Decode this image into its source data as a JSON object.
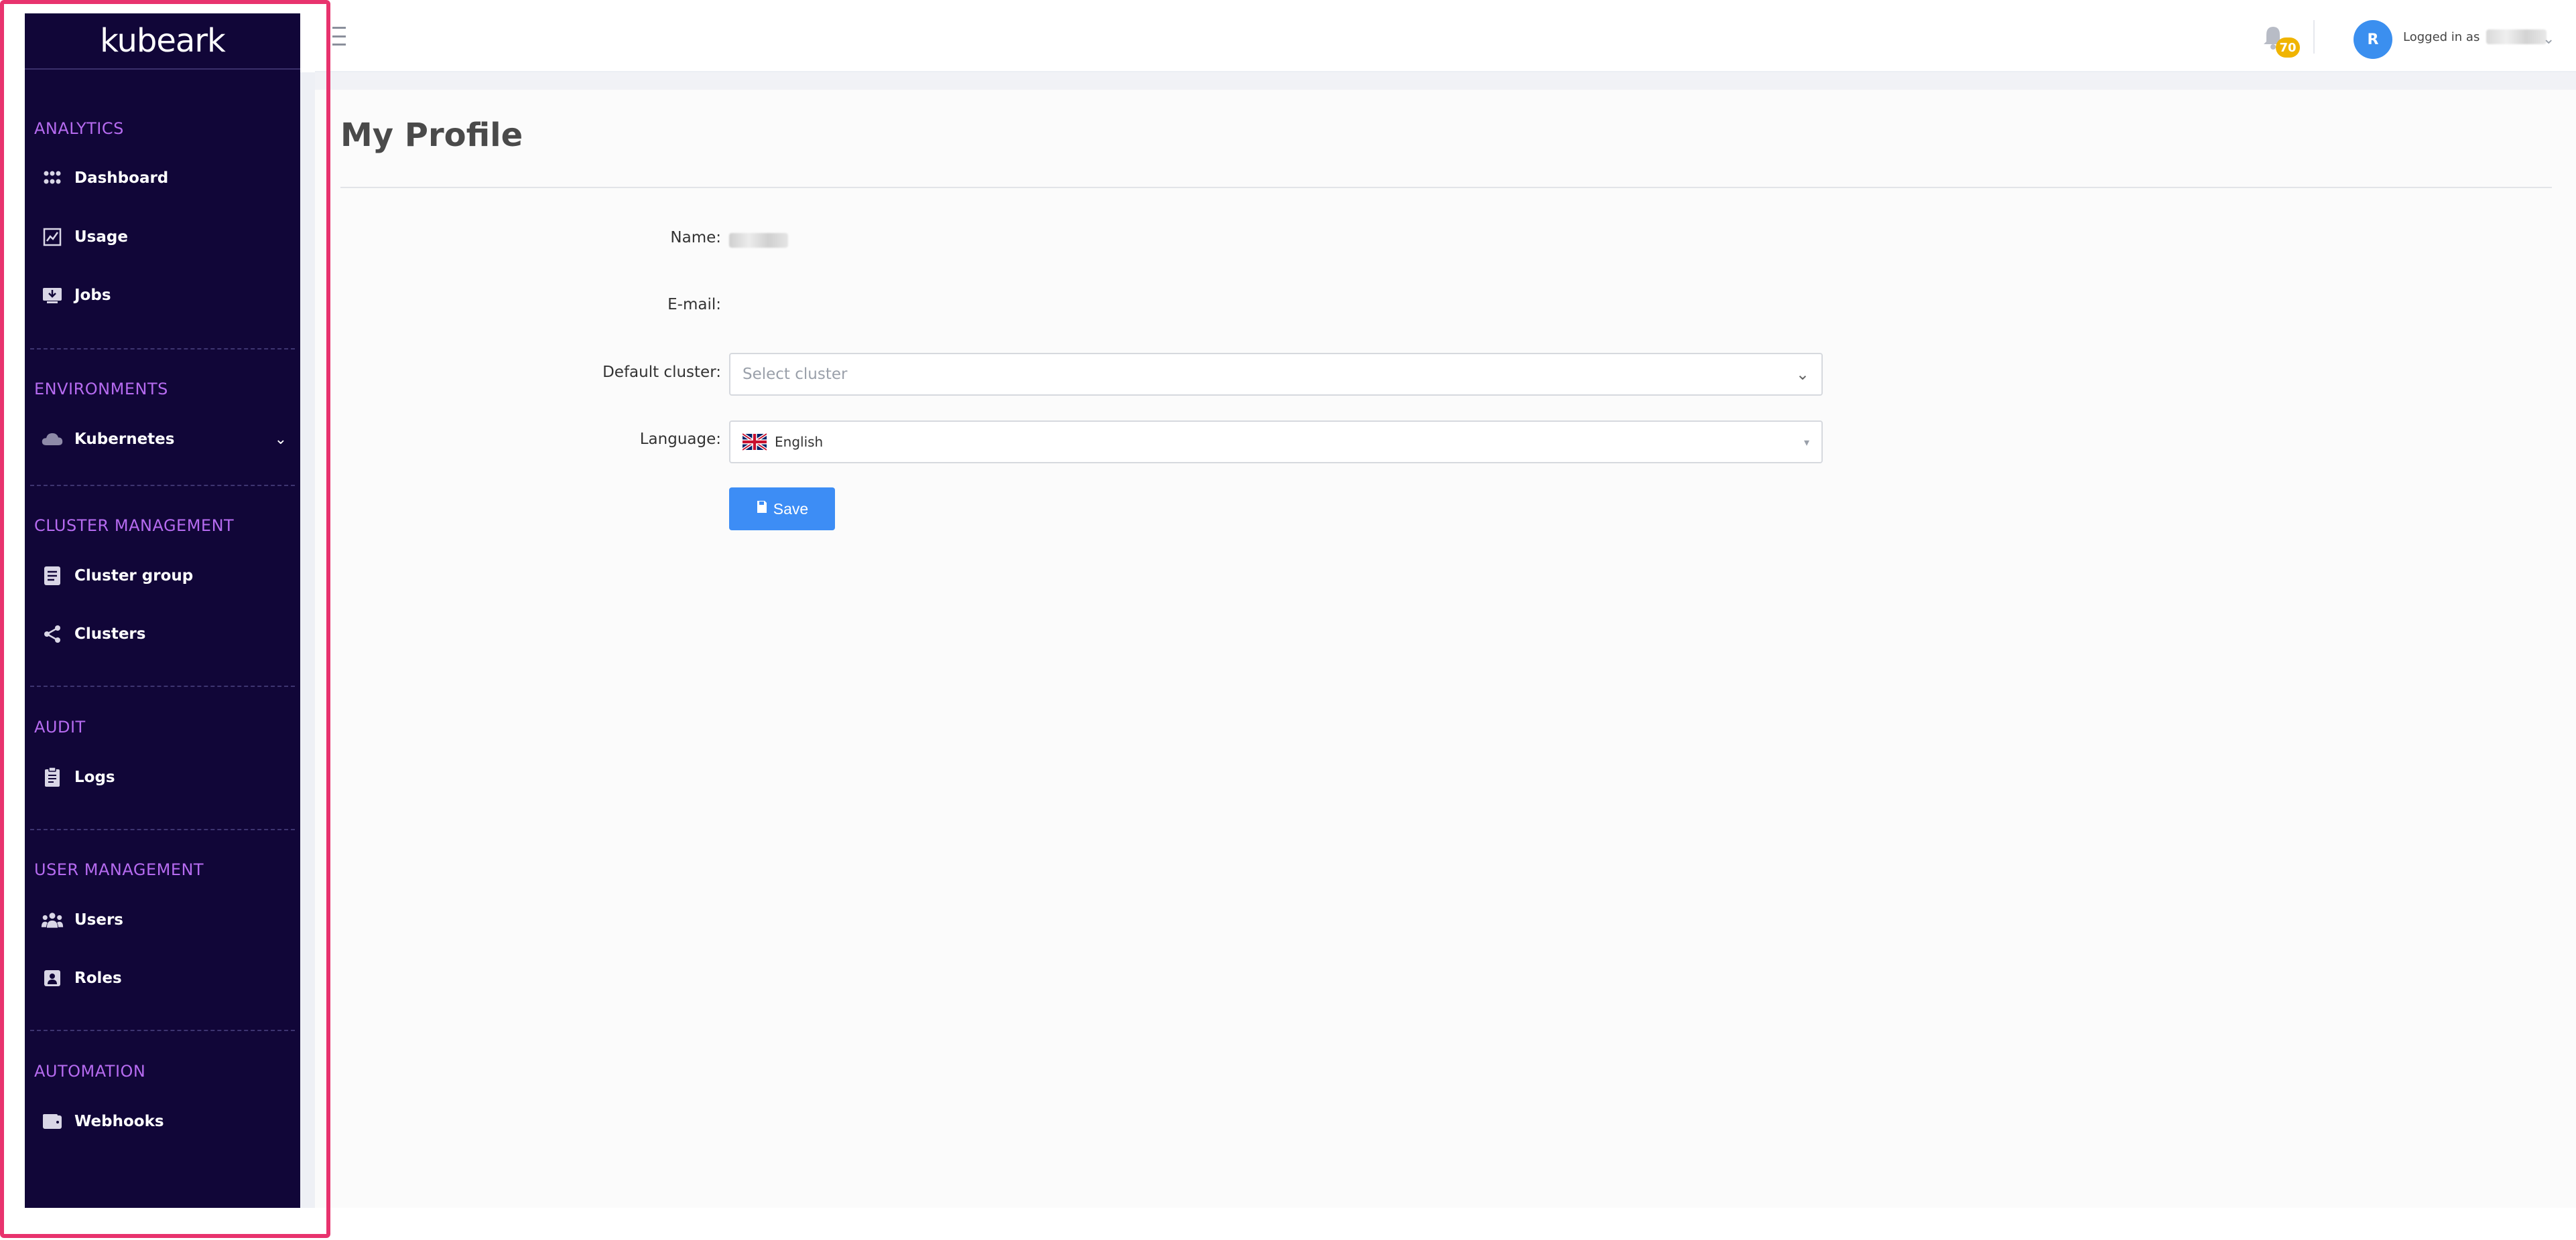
{
  "sidebar": {
    "brand": "kubeark",
    "sections": [
      {
        "title": "ANALYTICS",
        "items": [
          {
            "label": "Dashboard",
            "icon": "dashboard-icon"
          },
          {
            "label": "Usage",
            "icon": "chart-icon"
          },
          {
            "label": "Jobs",
            "icon": "jobs-icon"
          }
        ]
      },
      {
        "title": "ENVIRONMENTS",
        "items": [
          {
            "label": "Kubernetes",
            "icon": "cloud-icon"
          }
        ]
      },
      {
        "title": "CLUSTER MANAGEMENT",
        "items": [
          {
            "label": "Cluster group",
            "icon": "cluster-group-icon"
          },
          {
            "label": "Clusters",
            "icon": "share-nodes-icon"
          }
        ]
      },
      {
        "title": "AUDIT",
        "items": [
          {
            "label": "Logs",
            "icon": "clipboard-icon"
          }
        ]
      },
      {
        "title": "USER MANAGEMENT",
        "items": [
          {
            "label": "Users",
            "icon": "users-icon"
          },
          {
            "label": "Roles",
            "icon": "roles-icon"
          }
        ]
      },
      {
        "title": "AUTOMATION",
        "items": [
          {
            "label": "Webhooks",
            "icon": "wallet-icon"
          }
        ]
      }
    ]
  },
  "header": {
    "notification_count": "70",
    "avatar_initial": "R",
    "logged_in_prefix": "Logged in as"
  },
  "page": {
    "title": "My Profile"
  },
  "form": {
    "name_label": "Name:",
    "email_label": "E-mail:",
    "default_cluster_label": "Default cluster:",
    "default_cluster_placeholder": "Select cluster",
    "language_label": "Language:",
    "language_value": "English",
    "save_label": "Save"
  },
  "colors": {
    "sidebar_bg": "#110638",
    "section_title": "#b66bf0",
    "primary": "#3d8df5",
    "badge": "#f0b400",
    "highlight": "#e8336e"
  }
}
